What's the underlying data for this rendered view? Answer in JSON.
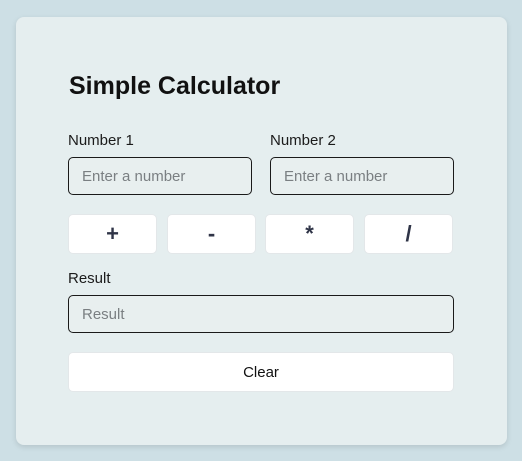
{
  "calculator": {
    "title": "Simple Calculator",
    "number1": {
      "label": "Number 1",
      "value": "",
      "placeholder": "Enter a number"
    },
    "number2": {
      "label": "Number 2",
      "value": "",
      "placeholder": "Enter a number"
    },
    "operations": {
      "add": "+",
      "subtract": "-",
      "multiply": "*",
      "divide": "/"
    },
    "result": {
      "label": "Result",
      "value": "",
      "placeholder": "Result"
    },
    "clear_label": "Clear"
  },
  "colors": {
    "page_background": "#cddfe5",
    "card_background": "#e5eeef",
    "operator_text": "#2f3447"
  }
}
